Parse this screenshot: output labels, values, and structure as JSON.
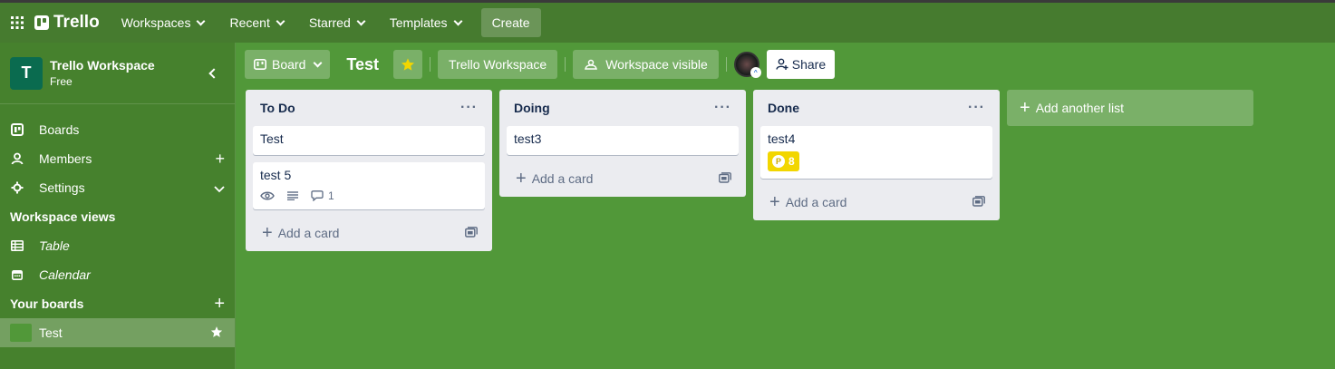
{
  "topbar": {
    "logo": "Trello",
    "nav": [
      {
        "label": "Workspaces"
      },
      {
        "label": "Recent"
      },
      {
        "label": "Starred"
      },
      {
        "label": "Templates"
      }
    ],
    "create_label": "Create"
  },
  "sidebar": {
    "workspace_initial": "T",
    "workspace_name": "Trello Workspace",
    "workspace_plan": "Free",
    "items": [
      {
        "label": "Boards"
      },
      {
        "label": "Members"
      },
      {
        "label": "Settings"
      }
    ],
    "views_title": "Workspace views",
    "views": [
      {
        "label": "Table"
      },
      {
        "label": "Calendar"
      }
    ],
    "boards_title": "Your boards",
    "boards": [
      {
        "label": "Test"
      }
    ]
  },
  "boardbar": {
    "view_label": "Board",
    "title": "Test",
    "workspace_label": "Trello Workspace",
    "visibility_label": "Workspace visible",
    "share_label": "Share"
  },
  "lists": [
    {
      "title": "To Do",
      "cards": [
        {
          "title": "Test"
        },
        {
          "title": "test 5",
          "comment_count": "1"
        }
      ],
      "add_label": "Add a card"
    },
    {
      "title": "Doing",
      "cards": [
        {
          "title": "test3"
        }
      ],
      "add_label": "Add a card"
    },
    {
      "title": "Done",
      "cards": [
        {
          "title": "test4",
          "points": "8"
        }
      ],
      "add_label": "Add a card"
    }
  ],
  "add_list_label": "Add another list",
  "colors": {
    "board_bg": "#519839",
    "topbar_bg": "#467b2f",
    "list_bg": "#ebecf0",
    "points_badge": "#f2d600"
  }
}
